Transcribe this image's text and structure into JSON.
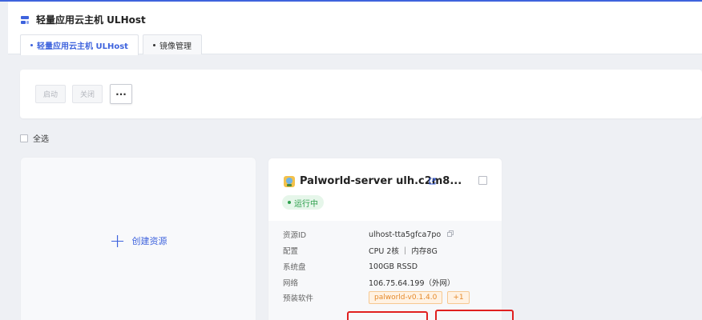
{
  "header": {
    "title": "轻量应用云主机 ULHost",
    "tabs": [
      {
        "label": "轻量应用云主机 ULHost",
        "active": true
      },
      {
        "label": "镜像管理",
        "active": false
      }
    ]
  },
  "toolbar": {
    "start_label": "启动",
    "stop_label": "关闭",
    "more_label": "···"
  },
  "select_all_label": "全选",
  "create_card": {
    "label": "创建资源"
  },
  "host": {
    "name": "Palworld-server ulh.c2m8...",
    "status": "运行中",
    "rows": [
      {
        "key": "资源ID",
        "value": "ulhost-tta5gfca7po"
      },
      {
        "key": "配置",
        "value": "CPU 2核 ｜ 内存8G"
      },
      {
        "key": "系统盘",
        "value": "100GB RSSD"
      },
      {
        "key": "网络",
        "value": "106.75.64.199（外网）"
      },
      {
        "key": "预装软件",
        "tags": [
          "palworld-v0.1.4.0",
          "+1"
        ]
      }
    ]
  },
  "colors": {
    "accent": "#3e63dd",
    "running": "#2ea04d",
    "tag": "#e58a2b",
    "highlight": "#e02020"
  }
}
